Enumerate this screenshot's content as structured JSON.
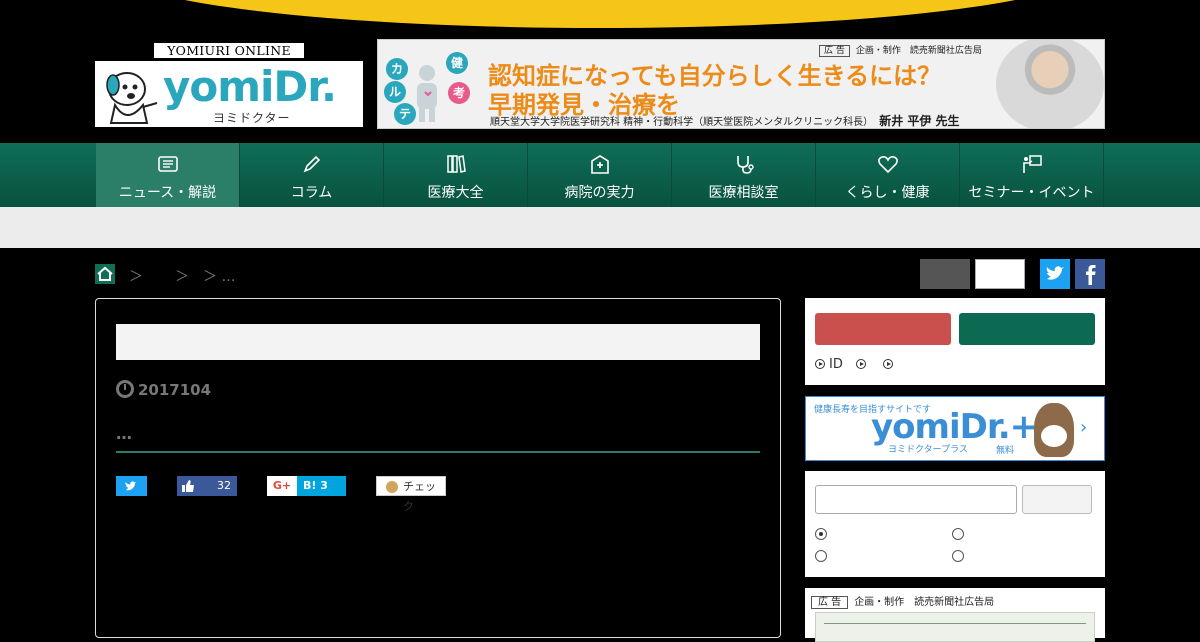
{
  "logo": {
    "online_label": "YOMIURI ONLINE",
    "brand": "yomiDr.",
    "kana": "ヨミドクター"
  },
  "ad_banner": {
    "tag": "広 告",
    "sponsor": "企画・制作　読売新聞社広告局",
    "headline_1": "認知症になっても自分らしく生きるには？",
    "headline_2": "早期発見・治療を",
    "affiliation": "順天堂大学大学院医学研究科 精神・行動科学（順天堂医院メンタルクリニック科長）",
    "doctor": "新井 平伊 先生",
    "bubbles": [
      "カ",
      "ル",
      "テ",
      "健",
      "考"
    ]
  },
  "nav": {
    "items": [
      {
        "label": "ニュース・解説",
        "icon": "newspaper-icon"
      },
      {
        "label": "コラム",
        "icon": "pen-icon"
      },
      {
        "label": "医療大全",
        "icon": "books-icon"
      },
      {
        "label": "病院の実力",
        "icon": "hospital-icon"
      },
      {
        "label": "医療相談室",
        "icon": "stethoscope-icon"
      },
      {
        "label": "くらし・健康",
        "icon": "heart-icon"
      },
      {
        "label": "セミナー・イベント",
        "icon": "presentation-icon"
      }
    ]
  },
  "breadcrumb": {
    "sep1": "＞",
    "sep2": "＞",
    "sep3": "＞ …"
  },
  "article": {
    "date": "2017104",
    "lead": "…",
    "share": {
      "like_count": "32",
      "gplus": "G+",
      "hatena": "B! 3",
      "mixi": "チェック"
    }
  },
  "sidebar": {
    "links": [
      "ID",
      "",
      ""
    ]
  },
  "yomidr_plus": {
    "caption": "健康長寿を目指すサイトです",
    "brand": "yomiDr.+",
    "kana": "ヨミドクタープラス",
    "free": "無料",
    "chevron": "›"
  },
  "ad2": {
    "tag": "広 告",
    "sponsor": "企画・制作　読売新聞社広告局"
  },
  "colors": {
    "nav_green": "#0f6e55",
    "accent_yellow": "#f5c518",
    "brand_blue": "#2aa6bd",
    "ad_orange": "#ec8b17"
  }
}
